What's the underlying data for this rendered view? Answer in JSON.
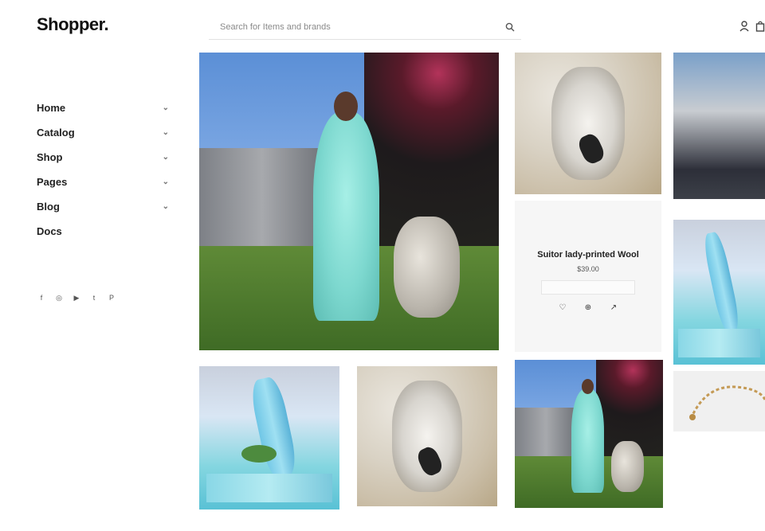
{
  "brand": {
    "logo": "Shopper."
  },
  "search": {
    "placeholder": "Search for Items and brands"
  },
  "nav": {
    "items": [
      {
        "label": "Home",
        "chevron": "⌄"
      },
      {
        "label": "Catalog",
        "chevron": "⌄"
      },
      {
        "label": "Shop",
        "chevron": "⌄"
      },
      {
        "label": "Pages",
        "chevron": "⌄"
      },
      {
        "label": "Blog",
        "chevron": "⌄"
      },
      {
        "label": "Docs",
        "chevron": ""
      }
    ]
  },
  "social": [
    "f",
    "◎",
    "▶",
    "t",
    "P"
  ],
  "product_card": {
    "name": "Suitor lady-printed Wool",
    "price": "$39.00",
    "actions": [
      "♡",
      "⊕",
      "↗"
    ]
  },
  "colors": {
    "text": "#1a1a1a",
    "muted": "#8a8a8a",
    "card_bg": "#f6f6f6"
  }
}
